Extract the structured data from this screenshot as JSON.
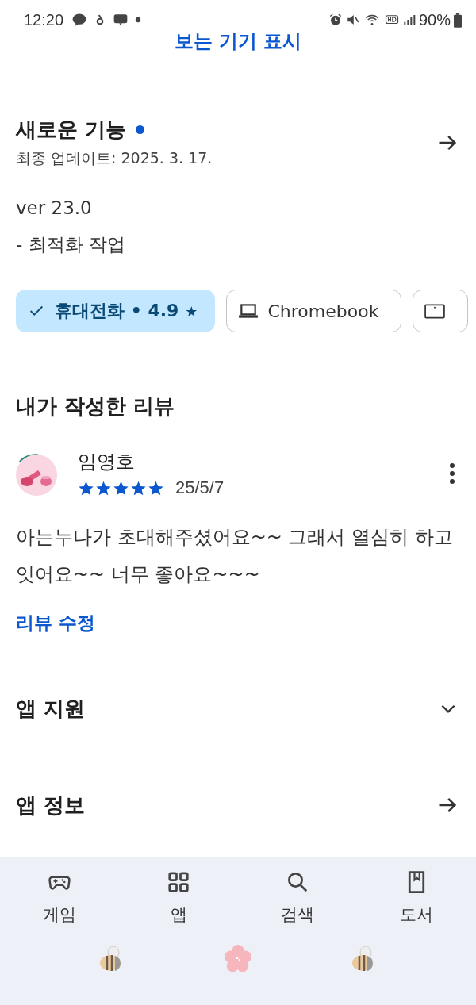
{
  "status_bar": {
    "time": "12:20",
    "battery": "90%"
  },
  "top_link": "보는 기기 표시",
  "whats_new": {
    "title": "새로운 기능",
    "unread": true,
    "updated": "최종 업데이트: 2025. 3. 17.",
    "lines": [
      "ver 23.0",
      "- 최적화 작업"
    ]
  },
  "device_chips": [
    {
      "kind": "phone",
      "label": "휴대전화 • 4.9",
      "star": "★",
      "selected": true
    },
    {
      "kind": "laptop",
      "label": "Chromebook",
      "selected": false
    },
    {
      "kind": "tablet",
      "selected": false
    }
  ],
  "my_review": {
    "heading": "내가 작성한 리뷰",
    "author": "임영호",
    "stars": 5,
    "date": "25/5/7",
    "text": "아는누나가 초대해주셨어요~~ 그래서 열심히 하고 잇어요~~ 너무 좋아요~~~",
    "edit_link": "리뷰 수정"
  },
  "sections": [
    {
      "title": "앱 지원",
      "kind": "expand"
    },
    {
      "title": "앱 정보",
      "kind": "arrow"
    }
  ],
  "bottom_nav": [
    {
      "kind": "games",
      "label": "게임",
      "selected": false
    },
    {
      "kind": "apps",
      "label": "앱",
      "selected": false
    },
    {
      "kind": "search",
      "label": "검색",
      "selected": false
    },
    {
      "kind": "books",
      "label": "도서",
      "selected": false
    }
  ]
}
